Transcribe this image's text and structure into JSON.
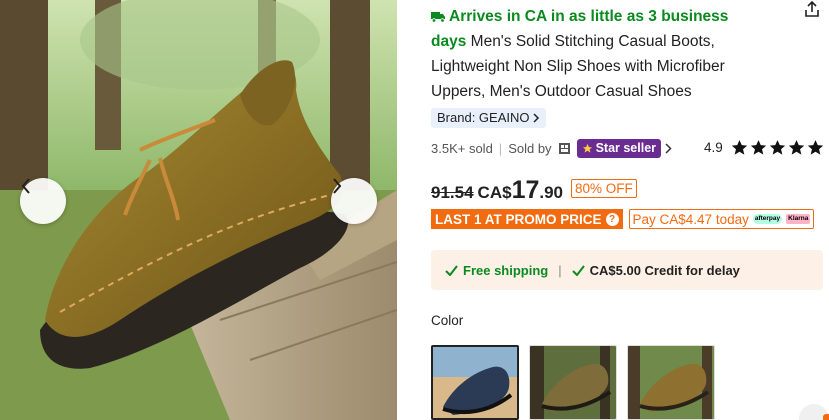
{
  "product": {
    "arrival_text": "Arrives in CA in as little as 3 business days",
    "title_text": "Men's Solid Stitching Casual Boots, Lightweight Non Slip Shoes with Microfiber Uppers, Men's Outdoor Casual Shoes",
    "brand_label": "Brand: GEAINO",
    "sold_count": "3.5K+ sold",
    "sold_by": "Sold by",
    "seller_badge": "Star seller",
    "rating_value": "4.9",
    "rating_stars": 5
  },
  "pricing": {
    "original_price": "91.54",
    "currency_prefix": "CA$",
    "price_whole": "17",
    "price_cents": ".90",
    "discount_badge": "80% OFF",
    "promo_label": "LAST 1 AT PROMO PRICE",
    "pay_label": "Pay CA$4.47 today",
    "afterpay_label": "afterpay",
    "klarna_label": "Klarna"
  },
  "shipping": {
    "free_shipping": "Free shipping",
    "credit_text": "CA$5.00 Credit for delay"
  },
  "color": {
    "label": "Color",
    "options": [
      "navy",
      "khaki",
      "brown"
    ],
    "selected_index": 0
  },
  "icons": {
    "share": "share-icon",
    "prev": "chevron-left-icon",
    "next": "chevron-right-icon",
    "truck": "truck-icon",
    "check": "check-icon",
    "star": "star-icon"
  },
  "colors": {
    "green": "#0a8a1f",
    "orange": "#f26b10",
    "seller_purple": "#6a2c91",
    "ship_bg": "#fdf0e6"
  }
}
